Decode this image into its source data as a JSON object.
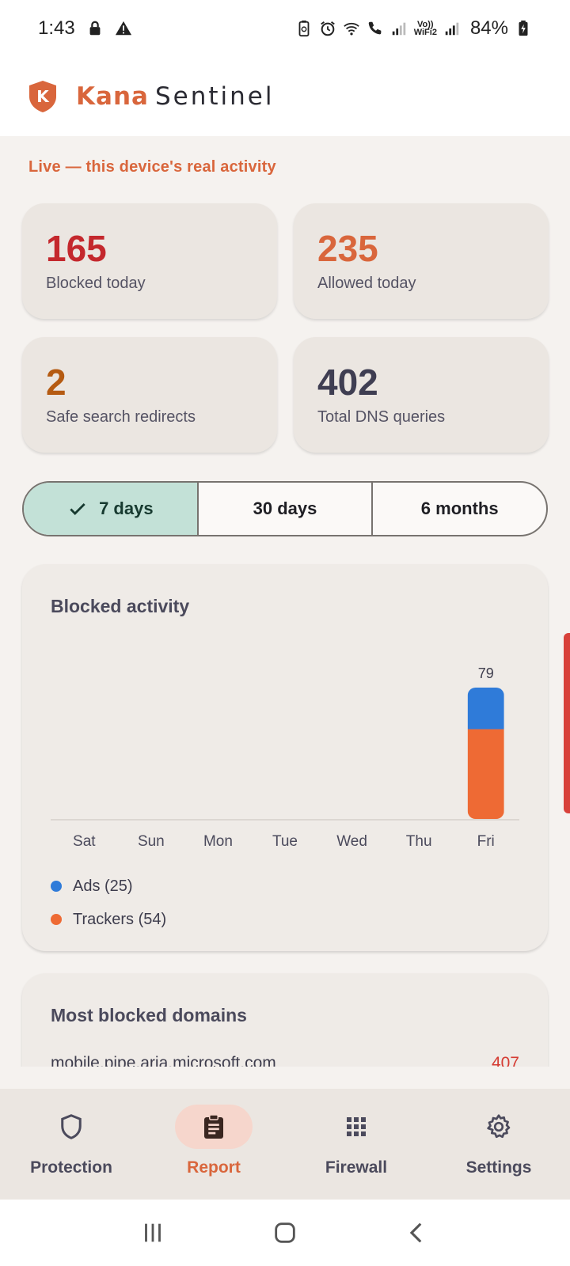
{
  "status_bar": {
    "time": "1:43",
    "battery_percent": "84%",
    "volte_label": "Vo))",
    "wifi_label": "WiFi2"
  },
  "app_bar": {
    "brand_primary": "Kana",
    "brand_secondary": "Sentinel",
    "logo_letter": "K"
  },
  "live_label": "Live — this device's real activity",
  "stats": {
    "blocked": {
      "value": "165",
      "label": "Blocked today",
      "color": "#c4282d"
    },
    "allowed": {
      "value": "235",
      "label": "Allowed today",
      "color": "#d9663c"
    },
    "safe_search": {
      "value": "2",
      "label": "Safe search redirects",
      "color": "#b55b12"
    },
    "total": {
      "value": "402",
      "label": "Total DNS queries",
      "color": "#3f3e52"
    }
  },
  "range_options": [
    {
      "label": "7 days",
      "selected": true
    },
    {
      "label": "30 days",
      "selected": false
    },
    {
      "label": "6 months",
      "selected": false
    }
  ],
  "chart_card_title": "Blocked activity",
  "chart_data": {
    "type": "bar",
    "stacked": true,
    "categories": [
      "Sat",
      "Sun",
      "Mon",
      "Tue",
      "Wed",
      "Thu",
      "Fri"
    ],
    "series": [
      {
        "name": "Ads",
        "values": [
          0,
          0,
          0,
          0,
          0,
          0,
          25
        ],
        "color": "#2f7bd9"
      },
      {
        "name": "Trackers",
        "values": [
          0,
          0,
          0,
          0,
          0,
          0,
          54
        ],
        "color": "#ee6a34"
      }
    ],
    "totals": [
      0,
      0,
      0,
      0,
      0,
      0,
      79
    ],
    "ylim": [
      0,
      79
    ],
    "grid": false
  },
  "legend": [
    {
      "label": "Ads (25)",
      "color": "#2f7bd9"
    },
    {
      "label": "Trackers (54)",
      "color": "#ee6a34"
    }
  ],
  "domains_card": {
    "title": "Most blocked domains",
    "first_row": {
      "domain": "mobile.pipe.aria.microsoft.com",
      "count": "407"
    }
  },
  "bottom_nav": [
    {
      "label": "Protection",
      "icon": "shield-icon",
      "active": false
    },
    {
      "label": "Report",
      "icon": "clipboard-icon",
      "active": true
    },
    {
      "label": "Firewall",
      "icon": "grid-icon",
      "active": false
    },
    {
      "label": "Settings",
      "icon": "gear-icon",
      "active": false
    }
  ]
}
